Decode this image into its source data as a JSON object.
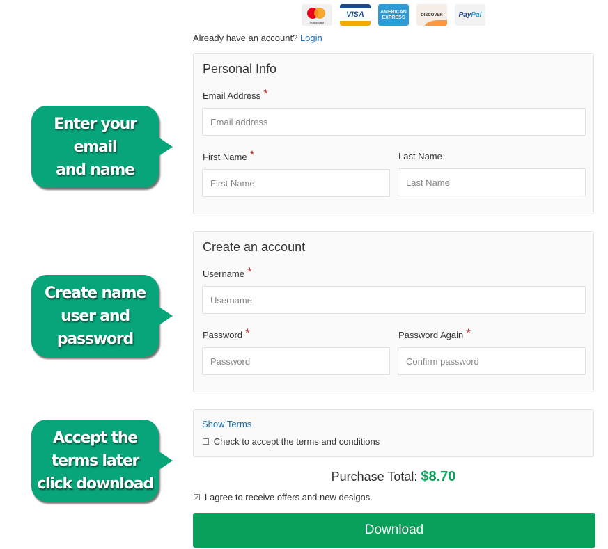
{
  "payment_methods": {
    "mastercard": {
      "label": "mastercard"
    },
    "visa": {
      "label": "VISA"
    },
    "amex": {
      "line1": "AMERICAN",
      "line2": "EXPRESS"
    },
    "discover": {
      "label": "DISCOVER"
    },
    "paypal": {
      "pay": "Pay",
      "pal": "Pal"
    }
  },
  "login_prompt": {
    "text": "Already have an account? ",
    "link": "Login"
  },
  "personal_info": {
    "title": "Personal Info",
    "email": {
      "label": "Email Address",
      "required": "*",
      "placeholder": "Email address"
    },
    "first_name": {
      "label": "First Name",
      "required": "*",
      "placeholder": "First Name"
    },
    "last_name": {
      "label": "Last Name",
      "placeholder": "Last Name"
    }
  },
  "create_account": {
    "title": "Create an account",
    "username": {
      "label": "Username",
      "required": "*",
      "placeholder": "Username"
    },
    "password": {
      "label": "Password",
      "required": "*",
      "placeholder": "Password"
    },
    "password_again": {
      "label": "Password Again",
      "required": "*",
      "placeholder": "Confirm password"
    }
  },
  "terms": {
    "show_terms": "Show Terms",
    "checkbox_glyph": "☐",
    "accept_label": "Check to accept the terms and conditions"
  },
  "purchase": {
    "label": "Purchase Total: ",
    "amount": "$8.70"
  },
  "offers": {
    "checkbox_glyph": "☑",
    "label": "I agree to receive offers and new designs."
  },
  "download_button": "Download",
  "callouts": [
    {
      "text": "Enter your\nemail\nand name"
    },
    {
      "text": "Create name\nuser and\npassword"
    },
    {
      "text": "Accept the\nterms later\nclick download"
    }
  ],
  "colors": {
    "accent_green": "#08a05a",
    "callout_green": "#08a57a",
    "link_blue": "#1a6fb5",
    "required_red": "#b53333"
  }
}
